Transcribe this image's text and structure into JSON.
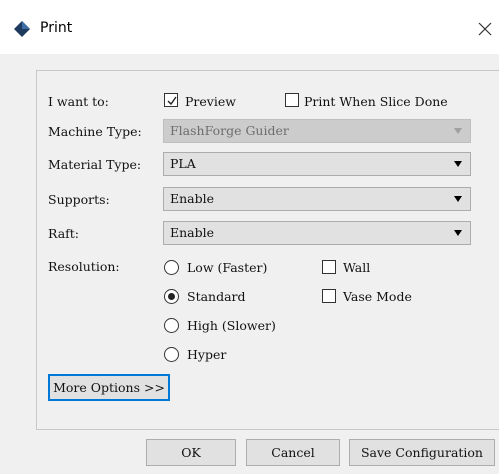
{
  "window": {
    "title": "Print",
    "close_glyph": "✕",
    "icon": "app-logo-icon"
  },
  "form": {
    "i_want_to_label": "I want to:",
    "preview": {
      "label": "Preview",
      "checked": true
    },
    "print_when_done": {
      "label": "Print When Slice Done",
      "checked": false
    },
    "machine_type": {
      "label": "Machine Type:",
      "value": "FlashForge Guider",
      "enabled": false
    },
    "material_type": {
      "label": "Material Type:",
      "value": "PLA"
    },
    "supports": {
      "label": "Supports:",
      "value": "Enable"
    },
    "raft": {
      "label": "Raft:",
      "value": "Enable"
    },
    "resolution": {
      "label": "Resolution:",
      "options": [
        {
          "label": "Low (Faster)",
          "selected": false
        },
        {
          "label": "Standard",
          "selected": true
        },
        {
          "label": "High (Slower)",
          "selected": false
        },
        {
          "label": "Hyper",
          "selected": false
        }
      ]
    },
    "wall": {
      "label": "Wall",
      "checked": false
    },
    "vase_mode": {
      "label": "Vase Mode",
      "checked": false
    },
    "more_options_label": "More Options >>"
  },
  "buttons": {
    "ok": "OK",
    "cancel": "Cancel",
    "save": "Save Configuration"
  },
  "colors": {
    "focus_accent": "#0078d7",
    "dialog_bg": "#f0f0f0",
    "logo": "#1f3a5f"
  }
}
